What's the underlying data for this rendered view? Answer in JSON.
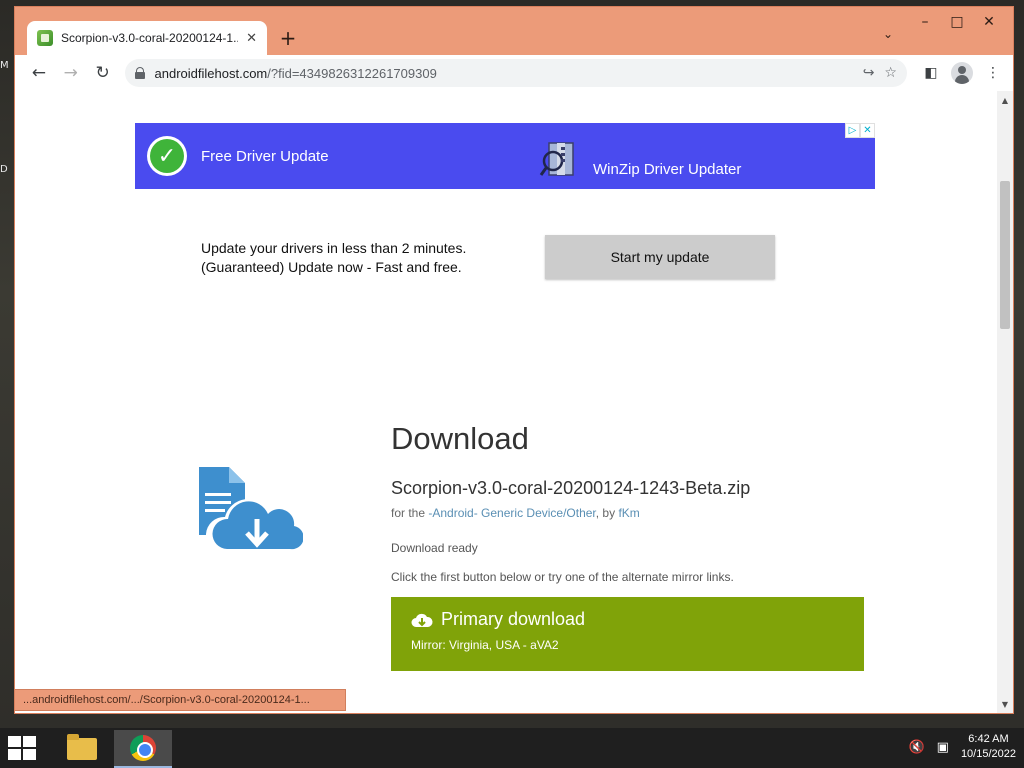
{
  "window": {
    "minimize": "–",
    "maximize": "□",
    "close": "✕"
  },
  "tab": {
    "title": "Scorpion-v3.0-coral-20200124-1..",
    "close": "✕",
    "new_tab": "+",
    "tab_search": "⌄"
  },
  "toolbar": {
    "back": "←",
    "forward": "→",
    "reload": "↻",
    "url_host": "androidfilehost.com",
    "url_path": "/?fid=4349826312261709309",
    "share": "↪",
    "bookmark": "☆",
    "sidepanel": "◧",
    "menu": "⋮"
  },
  "ad": {
    "badge_adchoices": "▷",
    "badge_close": "✕",
    "headline": "Free Driver Update",
    "brand": "WinZip Driver Updater",
    "copy_line1": "Update your drivers in less than 2 minutes.",
    "copy_line2": "(Guaranteed) Update now - Fast and free.",
    "cta": "Start my update"
  },
  "download": {
    "heading": "Download",
    "filename": "Scorpion-v3.0-coral-20200124-1243-Beta.zip",
    "meta_prefix": "for the ",
    "meta_platform": "-Android- Generic Device/Other",
    "meta_by": ", by ",
    "meta_author": "fKm",
    "status": "Download ready",
    "hint": "Click the first button below or try one of the alternate mirror links.",
    "primary_label": "Primary download",
    "primary_mirror": "Mirror: Virginia, USA - aVA2"
  },
  "status_bar": {
    "url": "...androidfilehost.com/.../Scorpion-v3.0-coral-20200124-1..."
  },
  "desktop": {
    "edge_text_1": "M",
    "edge_text_2": "D"
  },
  "taskbar": {
    "time": "6:42 AM",
    "date": "10/15/2022",
    "volume_icon": "🔇",
    "network_icon": "▣"
  },
  "colors": {
    "window_frame": "#ec9b79",
    "ad_banner": "#4a4bef",
    "primary_download": "#80a309",
    "link": "#5a8fb4"
  }
}
